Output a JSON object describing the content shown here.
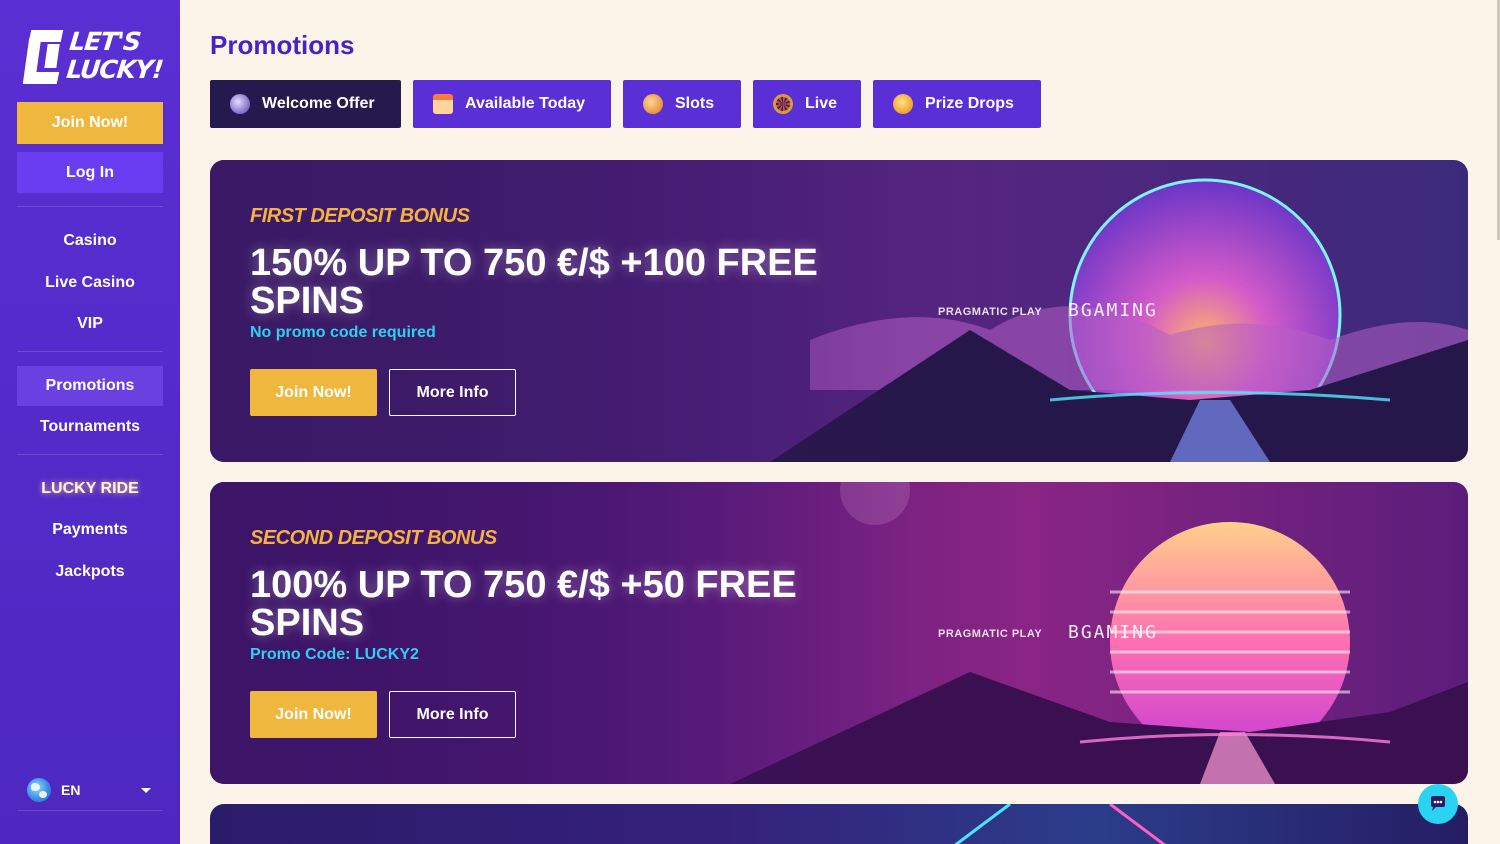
{
  "brand": {
    "logo_line1": "LET'S",
    "logo_line2": "LUCKY!"
  },
  "sidebar": {
    "join_label": "Join Now!",
    "login_label": "Log In",
    "nav_group1": [
      "Casino",
      "Live Casino",
      "VIP"
    ],
    "nav_group2": [
      "Promotions",
      "Tournaments"
    ],
    "nav_group3": [
      "LUCKY RIDE",
      "Payments",
      "Jackpots"
    ],
    "active_item": "Promotions",
    "language": "EN"
  },
  "page": {
    "title": "Promotions"
  },
  "filters": [
    {
      "label": "Welcome Offer",
      "icon": "rocket-icon",
      "active": true
    },
    {
      "label": "Available Today",
      "icon": "calendar-icon",
      "active": false
    },
    {
      "label": "Slots",
      "icon": "cookie-icon",
      "active": false
    },
    {
      "label": "Live",
      "icon": "roulette-icon",
      "active": false
    },
    {
      "label": "Prize Drops",
      "icon": "coin-icon",
      "active": false
    }
  ],
  "promos": [
    {
      "kicker": "FIRST DEPOSIT BONUS",
      "headline": "150% UP TO 750 €/$ +100 FREE SPINS",
      "sub": "No promo code required",
      "join_label": "Join Now!",
      "more_label": "More Info",
      "providers": [
        "PRAGMATIC PLAY",
        "BGAMING"
      ]
    },
    {
      "kicker": "SECOND DEPOSIT BONUS",
      "headline": "100% UP TO 750 €/$ +50 FREE SPINS",
      "sub": "Promo Code: LUCKY2",
      "join_label": "Join Now!",
      "more_label": "More Info",
      "providers": [
        "PRAGMATIC PLAY",
        "BGAMING"
      ]
    }
  ],
  "colors": {
    "sidebar": "#5a2fd3",
    "accent_gold": "#f0b73f",
    "title_violet": "#4a22c4",
    "cyan": "#2ed0f0",
    "background": "#fdf4e9"
  }
}
